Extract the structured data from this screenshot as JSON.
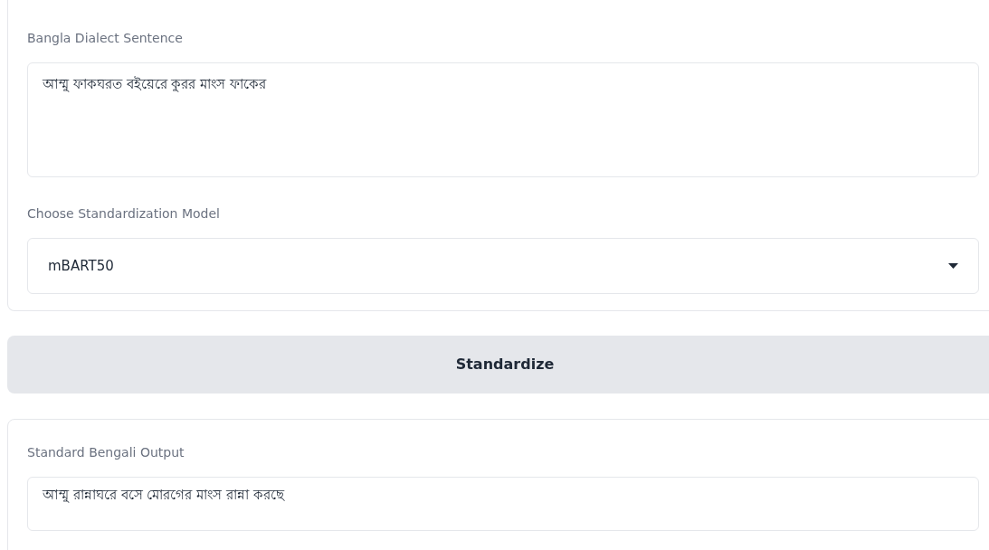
{
  "input_panel": {
    "sentence_label": "Bangla Dialect Sentence",
    "sentence_value": "আম্মু ফাকঘরত বইয়েরে কুরর মাংস ফাকের",
    "model_label": "Choose Standardization Model",
    "model_value": "mBART50"
  },
  "action_button": {
    "label": "Standardize"
  },
  "output_panel": {
    "label": "Standard Bengali Output",
    "value": "আম্মু রান্নাঘরে বসে মোরগের মাংস রান্না করছে"
  }
}
